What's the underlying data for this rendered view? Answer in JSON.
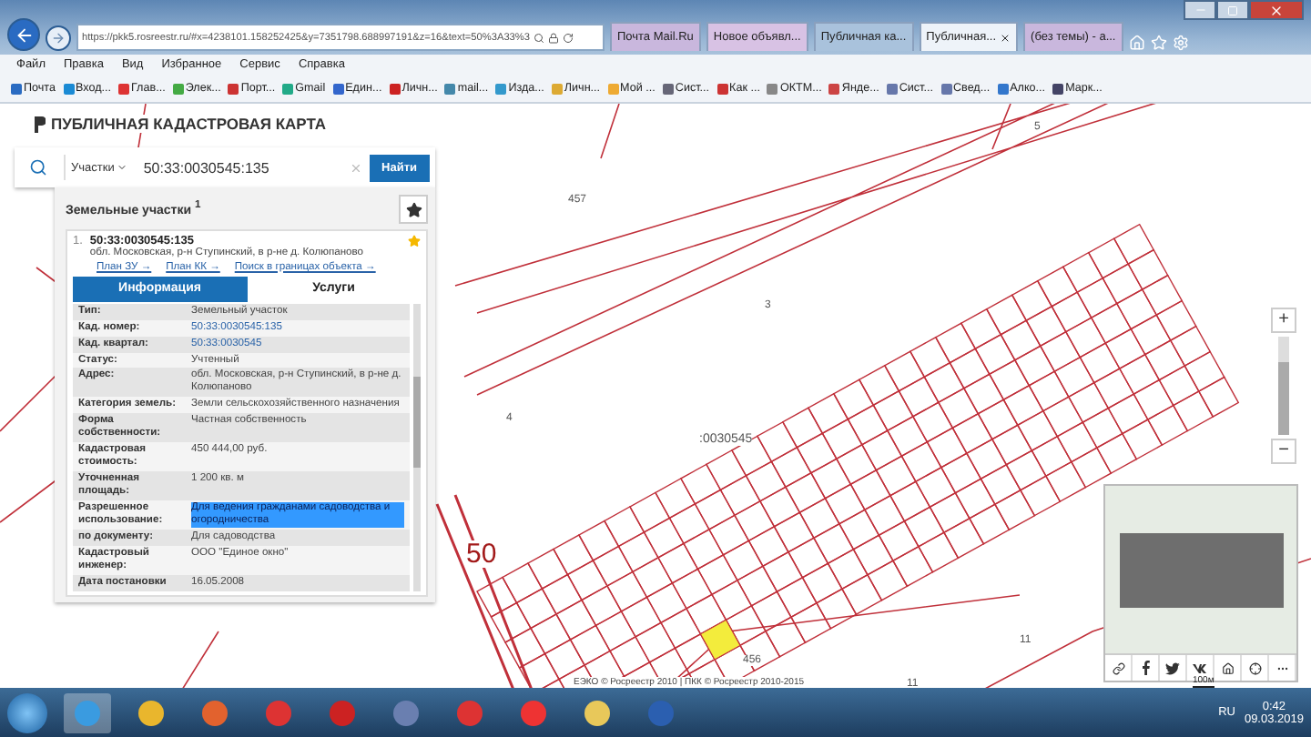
{
  "browser": {
    "url": "https://pkk5.rosreestr.ru/#x=4238101.158252425&y=7351798.688997191&z=16&text=50%3A33%3",
    "tabs": [
      {
        "label": "Почта Mail.Ru",
        "selected": false
      },
      {
        "label": "Новое объявл...",
        "selected": false
      },
      {
        "label": "Публичная ка...",
        "selected": false
      },
      {
        "label": "Публичная...",
        "selected": true
      },
      {
        "label": "(без темы) - а...",
        "selected": false
      }
    ],
    "menu": [
      "Файл",
      "Правка",
      "Вид",
      "Избранное",
      "Сервис",
      "Справка"
    ],
    "bookmarks": [
      "Почта",
      "Вход...",
      "Глав...",
      "Элек...",
      "Порт...",
      "Gmail",
      "Един...",
      "Личн...",
      "mail...",
      "Изда...",
      "Личн...",
      "Мой ...",
      "Сист...",
      "Как ...",
      "ОКТМ...",
      "Янде...",
      "Сист...",
      "Свед...",
      "Алко...",
      "Марк..."
    ]
  },
  "panel": {
    "title": "ПУБЛИЧНАЯ КАДАСТРОВАЯ КАРТА",
    "search": {
      "category": "Участки",
      "value": "50:33:0030545:135",
      "button": "Найти"
    },
    "results_header": "Земельные участки $^{1}$",
    "result": {
      "index": "1.",
      "number": "50:33:0030545:135",
      "address": "обл. Московская, р-н Ступинский, в р-не д. Колюпаново",
      "favorite": true,
      "links": [
        "План ЗУ →",
        "План КК →",
        "Поиск в границах объекта →"
      ]
    },
    "tabs": [
      {
        "label": "Информация",
        "selected": true
      },
      {
        "label": "Услуги",
        "selected": false
      }
    ],
    "rows": [
      {
        "label": "Тип:",
        "value": "Земельный участок",
        "kind": "text",
        "highlighted": false
      },
      {
        "label": "Кад. номер:",
        "value": "50:33:0030545:135",
        "kind": "link",
        "highlighted": false
      },
      {
        "label": "Кад. квартал:",
        "value": "50:33:0030545",
        "kind": "link",
        "highlighted": false
      },
      {
        "label": "Статус:",
        "value": "Учтенный",
        "kind": "text",
        "highlighted": false
      },
      {
        "label": "Адрес:",
        "value": "обл. Московская, р-н Ступинский, в р-не д. Колюпаново",
        "kind": "text",
        "highlighted": false
      },
      {
        "label": "Категория земель:",
        "value": "Земли сельскохозяйственного назначения",
        "kind": "text",
        "highlighted": false
      },
      {
        "label": "Форма собственности:",
        "value": "Частная собственность",
        "kind": "text",
        "highlighted": false
      },
      {
        "label": "Кадастровая стоимость:",
        "value": "450 444,00 руб.",
        "kind": "text",
        "highlighted": false
      },
      {
        "label": "Уточненная площадь:",
        "value": "1 200 кв. м",
        "kind": "text",
        "highlighted": false
      },
      {
        "label": "Разрешенное использование:",
        "value": "Для ведения гражданами садоводства и огородничества",
        "kind": "text",
        "highlighted": true
      },
      {
        "label": "по документу:",
        "value": "Для садоводства",
        "kind": "text",
        "highlighted": false
      },
      {
        "label": "Кадастровый инженер:",
        "value": "ООО \"Единое окно\"",
        "kind": "text",
        "highlighted": false
      },
      {
        "label": "Дата постановки",
        "value": "16.05.2008",
        "kind": "text",
        "highlighted": false
      }
    ]
  },
  "map": {
    "labels": [
      "457",
      "5",
      "3",
      "4",
      ":0030545",
      "50",
      "11",
      "11",
      "456"
    ],
    "zoom": {
      "plus": "+",
      "minus": "−",
      "level": 0.75
    },
    "attribution": "ЕЭКО © Росреестр 2010 | ПКК © Росреестр 2010-2015",
    "scale": "100м"
  },
  "taskbar": {
    "language": "RU",
    "time": "0:42",
    "date": "09.03.2019"
  }
}
